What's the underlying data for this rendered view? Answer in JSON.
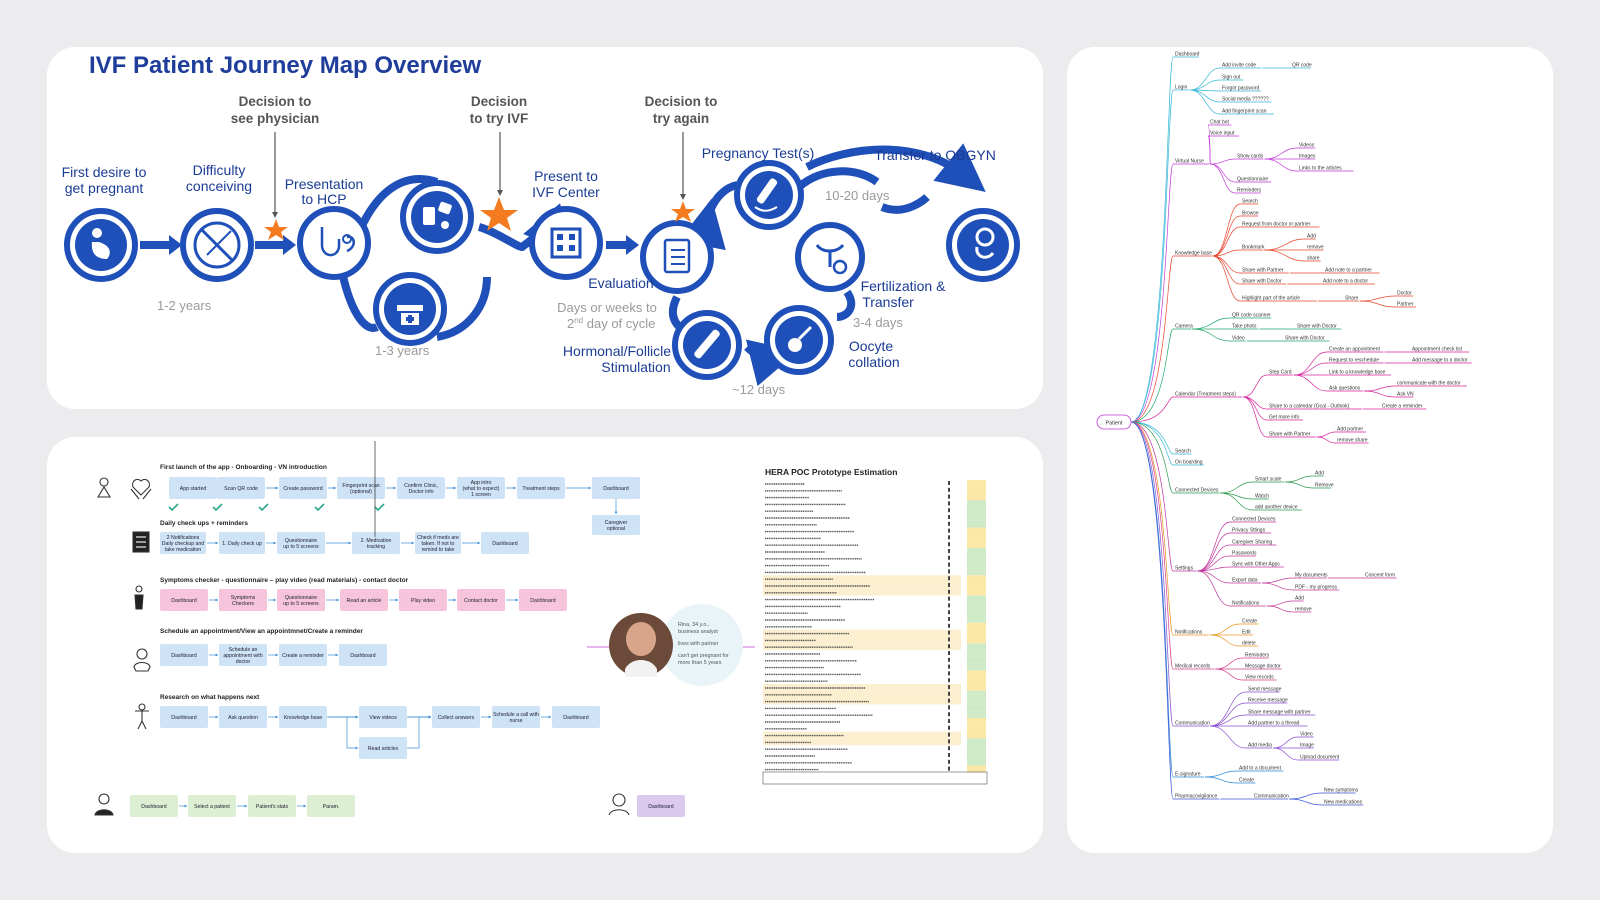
{
  "journey": {
    "title": "IVF Patient Journey Map Overview",
    "stages": {
      "first_desire": [
        "First desire to",
        "get pregnant"
      ],
      "difficulty": [
        "Difficulty",
        "conceiving"
      ],
      "presentation_hcp": [
        "Presentation",
        "to HCP"
      ],
      "present_ivf": [
        "Present to",
        "IVF Center"
      ],
      "evaluation": [
        "Evaluation"
      ],
      "pregnancy_test": [
        "Pregnancy Test(s)"
      ],
      "transfer_obgyn": [
        "Transfer to OBGYN"
      ],
      "fertilization": [
        "Fertilization &",
        "Transfer"
      ],
      "oocyte": [
        "Oocyte",
        "collation"
      ],
      "hormonal": [
        "Hormonal/Follicle",
        "Stimulation"
      ]
    },
    "decisions": {
      "see_physician": [
        "Decision to",
        "see physician"
      ],
      "try_ivf": [
        "Decision",
        "to try IVF"
      ],
      "try_again": [
        "Decision to",
        "try again"
      ]
    },
    "durations": {
      "d1": "1-2 years",
      "d2": "1-3 years",
      "d3_line1": "Days or weeks to",
      "d3_line2": "2",
      "d3_sup": "nd",
      "d3_line2b": " day of cycle",
      "d4": "10-20 days",
      "d5": "3-4 days",
      "d6": "~12 days"
    },
    "colors": {
      "primary": "#1f4fb8",
      "accent": "#f47b20",
      "title": "#1f3d9a"
    }
  },
  "flows": {
    "titles": [
      "First launch of the app - Onboarding - VN introduction",
      "Daily check ups + reminders",
      "Symptoms checker - questionnaire – play video (read materials) - contact doctor",
      "Schedule an appointment/View an appointmnet/Create a reminder",
      "Research on what happens next"
    ],
    "row1": [
      "App started",
      "Scan QR code",
      "Create password",
      "Fingerprint scan",
      "Confirm Clinic,",
      "App intro",
      "Treatment steps",
      "Dashboard"
    ],
    "row1_sub": {
      "fingerprint": "(optional)",
      "confirm": "Doctor info",
      "intro1": "(what to expect)",
      "intro2": "1 screen"
    },
    "caregiver": [
      "Caregiver",
      "optional"
    ],
    "row2": {
      "notif": [
        "2 Notifications",
        "Daily checkup and",
        "take medication"
      ],
      "daily": "1. Daily check up",
      "quest": [
        "Questionnaire",
        "up to 5 screens"
      ],
      "med": [
        "2. Medication",
        "tracking"
      ],
      "check": [
        "Check if meds are",
        "taken. If not to",
        "remind to take"
      ],
      "dash": "Dashboard"
    },
    "row3": [
      "Dashboard",
      "Symptoms",
      "Checkers",
      "Questionnaire",
      "up to 5 screens",
      "Read an article",
      "Play video",
      "Contact doctor",
      "Dashboard"
    ],
    "row4": [
      "Dashboard",
      "Schedule an",
      "appointment with",
      "doctor",
      "Create a reminder",
      "Dashboard"
    ],
    "row5": [
      "Dashboard",
      "Ask question",
      "Knowledge base",
      "View videos",
      "Read articles",
      "Collect answers",
      "Schedule a call with",
      "nurse",
      "Dashboard"
    ],
    "doctor_row": [
      "Dashboard",
      "Select a patient",
      "Patient's stats",
      "Param."
    ],
    "admin_row": [
      "Dashboard"
    ],
    "colors": {
      "blue": "#cfe3f7",
      "pink": "#f6c5dc",
      "green": "#dcefd2",
      "purple": "#dcc9ee",
      "check": "#2aa58c"
    }
  },
  "persona": {
    "lines": [
      "Rina, 34 y.o.,",
      "business analyst",
      "lives with partner",
      "can't get pregnant for",
      "more than 5 years"
    ]
  },
  "estimation": {
    "title": "HERA POC Prototype Estimation"
  },
  "mindmap": {
    "root": "Patient",
    "nodes": {
      "dashboard": "Dashboard",
      "login": "Login",
      "add_invite": "Add invite code",
      "qr": "QR code",
      "sign_out": "Sign out",
      "forgot": "Forgot password",
      "social": "Social media ??????",
      "add_fp": "Add fingerprint scan",
      "vn": "Virtual Nurse",
      "chatbot": "Chat bot",
      "voice": "Voice input",
      "show_cards": "Show cards",
      "videos": "Videos",
      "images": "Images",
      "links": "Links to the articles",
      "questionnaire": "Questionnaire",
      "reminders_vn": "Reminders",
      "kb": "Knowledge base",
      "search_kb": "Search",
      "browse": "Browse",
      "request": "Request from doctor or partner",
      "bookmark": "Bookmark",
      "add_bm": "Add",
      "remove_bm": "remove",
      "share_bm": "share",
      "share_partner": "Share with Partner",
      "add_note_partner": "Add note to a partner",
      "share_doctor": "Share with Doctor",
      "add_note_doctor": "Add note to a doctor",
      "highlight": "Highlight part of the article",
      "share_h": "Share",
      "doctor_h": "Doctor",
      "partner_h": "Partner",
      "camera": "Camera",
      "qr_scanner": "QR code scanner",
      "take_photo": "Take photo",
      "share_doc_cam": "Share with Doctor",
      "video_cam": "Video",
      "share_doc_vid": "Share with Doctor",
      "calendar": "Calendar (Treatment steps)",
      "step_card": "Step Card",
      "create_appt": "Create an appointment",
      "appt_check": "Appointment check list",
      "req_resched": "Request to reschedule",
      "add_msg_doc": "Add message to a doctor",
      "link_kb": "Link to a knowledge base",
      "ask_q": "Ask questions",
      "comm_doc": "communicate with the doctor",
      "ask_vn": "Ask VN",
      "share_cal": "Share to a calendar (Gcal - Outlook)",
      "create_rem": "Create a reminder",
      "get_info": "Get more info",
      "share_w_partner": "Share with Partner",
      "add_partner": "Add partner",
      "remove_share": "remove share",
      "search": "Search",
      "onboarding": "On boarding",
      "connected": "Connected Devices",
      "smart_scale": "Smart scale",
      "add_sc": "Add",
      "remove_sc": "Remove",
      "watch": "Watch",
      "add_device": "add another device",
      "settings": "Settings",
      "conn_dev_s": "Connected Devices",
      "privacy": "Privacy Sttings",
      "caregiver_sh": "Caregiver Sharing",
      "passwords": "Passwords",
      "sync": "Sync with Other Apps",
      "export": "Export data",
      "my_docs": "My documents",
      "concent": "Concent form",
      "pdf": "PDF - my progress",
      "notif_s": "Notifications",
      "add_n": "Add",
      "remove_n": "remove",
      "notifications": "Notifications",
      "create_n": "Create",
      "edit_n": "Edit",
      "delete_n": "delete",
      "medical": "Medical records",
      "reminders_m": "Reminders",
      "msg_doc": "Message doctor",
      "view_rec": "View records",
      "communication": "Communication",
      "send_msg": "Send message",
      "recv_msg": "Receive message",
      "share_msg": "Share message with partner",
      "add_thread": "Add partner to a thread",
      "add_media": "Add media",
      "video_c": "Video",
      "image_c": "Image",
      "upload_doc": "Upload document",
      "esig": "E-signature",
      "add_doc": "Add to a document",
      "create_e": "Create",
      "pharma": "Pharmacovigilance",
      "comm_ph": "Communication",
      "new_symptoms": "New symptoms",
      "new_meds": "New medications"
    },
    "colors": {
      "login": "#35b8d8",
      "vn": "#c23ad8",
      "kb": "#e8442c",
      "camera": "#1ea86a",
      "calendar": "#d6259a",
      "connected": "#2b9a4c",
      "settings": "#c2379e",
      "notif": "#e6961c",
      "medical": "#d83f8f",
      "comm": "#8a4fd0",
      "esig": "#2a86d6",
      "pharma": "#3a55d8"
    }
  }
}
